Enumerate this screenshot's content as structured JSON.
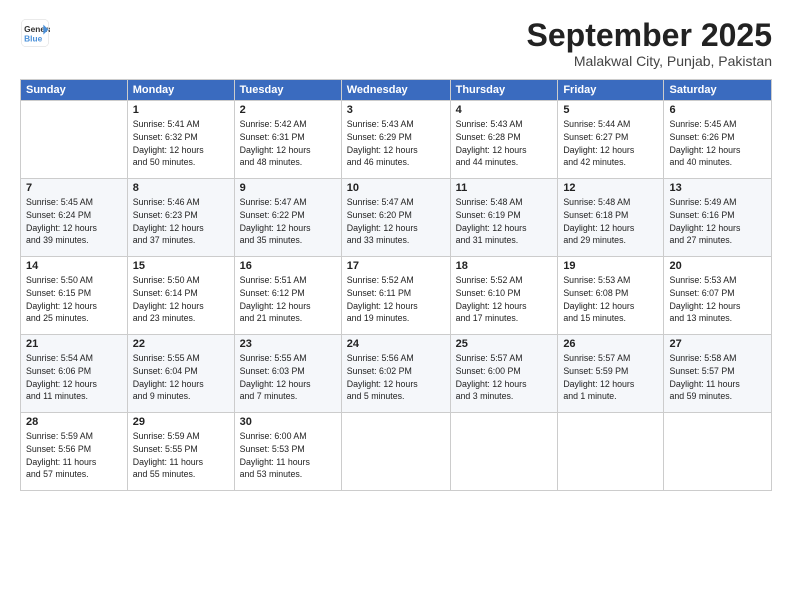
{
  "header": {
    "logo_line1": "General",
    "logo_line2": "Blue",
    "month": "September 2025",
    "location": "Malakwal City, Punjab, Pakistan"
  },
  "weekdays": [
    "Sunday",
    "Monday",
    "Tuesday",
    "Wednesday",
    "Thursday",
    "Friday",
    "Saturday"
  ],
  "weeks": [
    [
      {
        "num": "",
        "info": ""
      },
      {
        "num": "1",
        "info": "Sunrise: 5:41 AM\nSunset: 6:32 PM\nDaylight: 12 hours\nand 50 minutes."
      },
      {
        "num": "2",
        "info": "Sunrise: 5:42 AM\nSunset: 6:31 PM\nDaylight: 12 hours\nand 48 minutes."
      },
      {
        "num": "3",
        "info": "Sunrise: 5:43 AM\nSunset: 6:29 PM\nDaylight: 12 hours\nand 46 minutes."
      },
      {
        "num": "4",
        "info": "Sunrise: 5:43 AM\nSunset: 6:28 PM\nDaylight: 12 hours\nand 44 minutes."
      },
      {
        "num": "5",
        "info": "Sunrise: 5:44 AM\nSunset: 6:27 PM\nDaylight: 12 hours\nand 42 minutes."
      },
      {
        "num": "6",
        "info": "Sunrise: 5:45 AM\nSunset: 6:26 PM\nDaylight: 12 hours\nand 40 minutes."
      }
    ],
    [
      {
        "num": "7",
        "info": "Sunrise: 5:45 AM\nSunset: 6:24 PM\nDaylight: 12 hours\nand 39 minutes."
      },
      {
        "num": "8",
        "info": "Sunrise: 5:46 AM\nSunset: 6:23 PM\nDaylight: 12 hours\nand 37 minutes."
      },
      {
        "num": "9",
        "info": "Sunrise: 5:47 AM\nSunset: 6:22 PM\nDaylight: 12 hours\nand 35 minutes."
      },
      {
        "num": "10",
        "info": "Sunrise: 5:47 AM\nSunset: 6:20 PM\nDaylight: 12 hours\nand 33 minutes."
      },
      {
        "num": "11",
        "info": "Sunrise: 5:48 AM\nSunset: 6:19 PM\nDaylight: 12 hours\nand 31 minutes."
      },
      {
        "num": "12",
        "info": "Sunrise: 5:48 AM\nSunset: 6:18 PM\nDaylight: 12 hours\nand 29 minutes."
      },
      {
        "num": "13",
        "info": "Sunrise: 5:49 AM\nSunset: 6:16 PM\nDaylight: 12 hours\nand 27 minutes."
      }
    ],
    [
      {
        "num": "14",
        "info": "Sunrise: 5:50 AM\nSunset: 6:15 PM\nDaylight: 12 hours\nand 25 minutes."
      },
      {
        "num": "15",
        "info": "Sunrise: 5:50 AM\nSunset: 6:14 PM\nDaylight: 12 hours\nand 23 minutes."
      },
      {
        "num": "16",
        "info": "Sunrise: 5:51 AM\nSunset: 6:12 PM\nDaylight: 12 hours\nand 21 minutes."
      },
      {
        "num": "17",
        "info": "Sunrise: 5:52 AM\nSunset: 6:11 PM\nDaylight: 12 hours\nand 19 minutes."
      },
      {
        "num": "18",
        "info": "Sunrise: 5:52 AM\nSunset: 6:10 PM\nDaylight: 12 hours\nand 17 minutes."
      },
      {
        "num": "19",
        "info": "Sunrise: 5:53 AM\nSunset: 6:08 PM\nDaylight: 12 hours\nand 15 minutes."
      },
      {
        "num": "20",
        "info": "Sunrise: 5:53 AM\nSunset: 6:07 PM\nDaylight: 12 hours\nand 13 minutes."
      }
    ],
    [
      {
        "num": "21",
        "info": "Sunrise: 5:54 AM\nSunset: 6:06 PM\nDaylight: 12 hours\nand 11 minutes."
      },
      {
        "num": "22",
        "info": "Sunrise: 5:55 AM\nSunset: 6:04 PM\nDaylight: 12 hours\nand 9 minutes."
      },
      {
        "num": "23",
        "info": "Sunrise: 5:55 AM\nSunset: 6:03 PM\nDaylight: 12 hours\nand 7 minutes."
      },
      {
        "num": "24",
        "info": "Sunrise: 5:56 AM\nSunset: 6:02 PM\nDaylight: 12 hours\nand 5 minutes."
      },
      {
        "num": "25",
        "info": "Sunrise: 5:57 AM\nSunset: 6:00 PM\nDaylight: 12 hours\nand 3 minutes."
      },
      {
        "num": "26",
        "info": "Sunrise: 5:57 AM\nSunset: 5:59 PM\nDaylight: 12 hours\nand 1 minute."
      },
      {
        "num": "27",
        "info": "Sunrise: 5:58 AM\nSunset: 5:57 PM\nDaylight: 11 hours\nand 59 minutes."
      }
    ],
    [
      {
        "num": "28",
        "info": "Sunrise: 5:59 AM\nSunset: 5:56 PM\nDaylight: 11 hours\nand 57 minutes."
      },
      {
        "num": "29",
        "info": "Sunrise: 5:59 AM\nSunset: 5:55 PM\nDaylight: 11 hours\nand 55 minutes."
      },
      {
        "num": "30",
        "info": "Sunrise: 6:00 AM\nSunset: 5:53 PM\nDaylight: 11 hours\nand 53 minutes."
      },
      {
        "num": "",
        "info": ""
      },
      {
        "num": "",
        "info": ""
      },
      {
        "num": "",
        "info": ""
      },
      {
        "num": "",
        "info": ""
      }
    ]
  ]
}
